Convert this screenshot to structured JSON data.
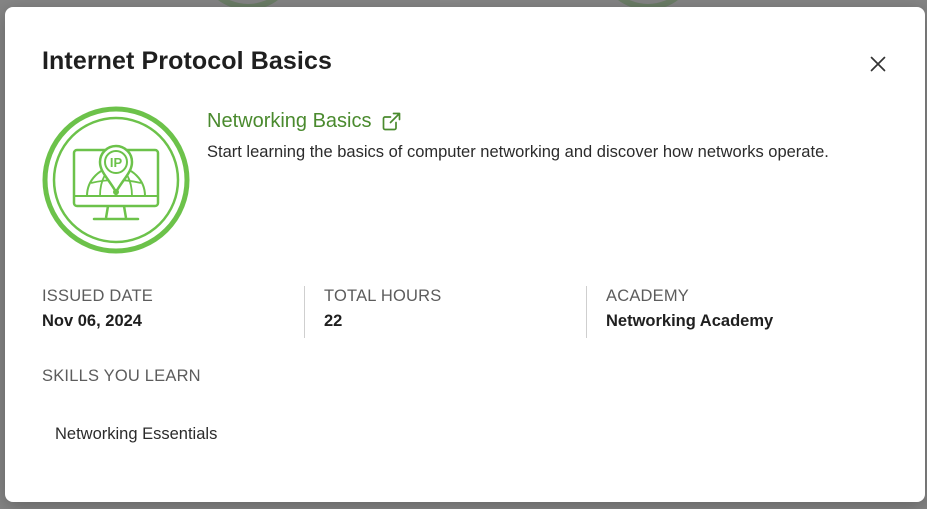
{
  "modal": {
    "title": "Internet Protocol Basics"
  },
  "course": {
    "link_label": "Networking Basics",
    "description": "Start learning the basics of computer networking and discover how networks operate.",
    "badge_text": "IP"
  },
  "stats": [
    {
      "label": "ISSUED DATE",
      "value": "Nov 06, 2024"
    },
    {
      "label": "TOTAL HOURS",
      "value": "22"
    },
    {
      "label": "ACADEMY",
      "value": "Networking Academy"
    }
  ],
  "skills": {
    "label": "SKILLS YOU LEARN",
    "items": [
      "Networking Essentials"
    ]
  },
  "colors": {
    "brand_green": "#6cc24a",
    "link_green": "#4a8a2e"
  }
}
